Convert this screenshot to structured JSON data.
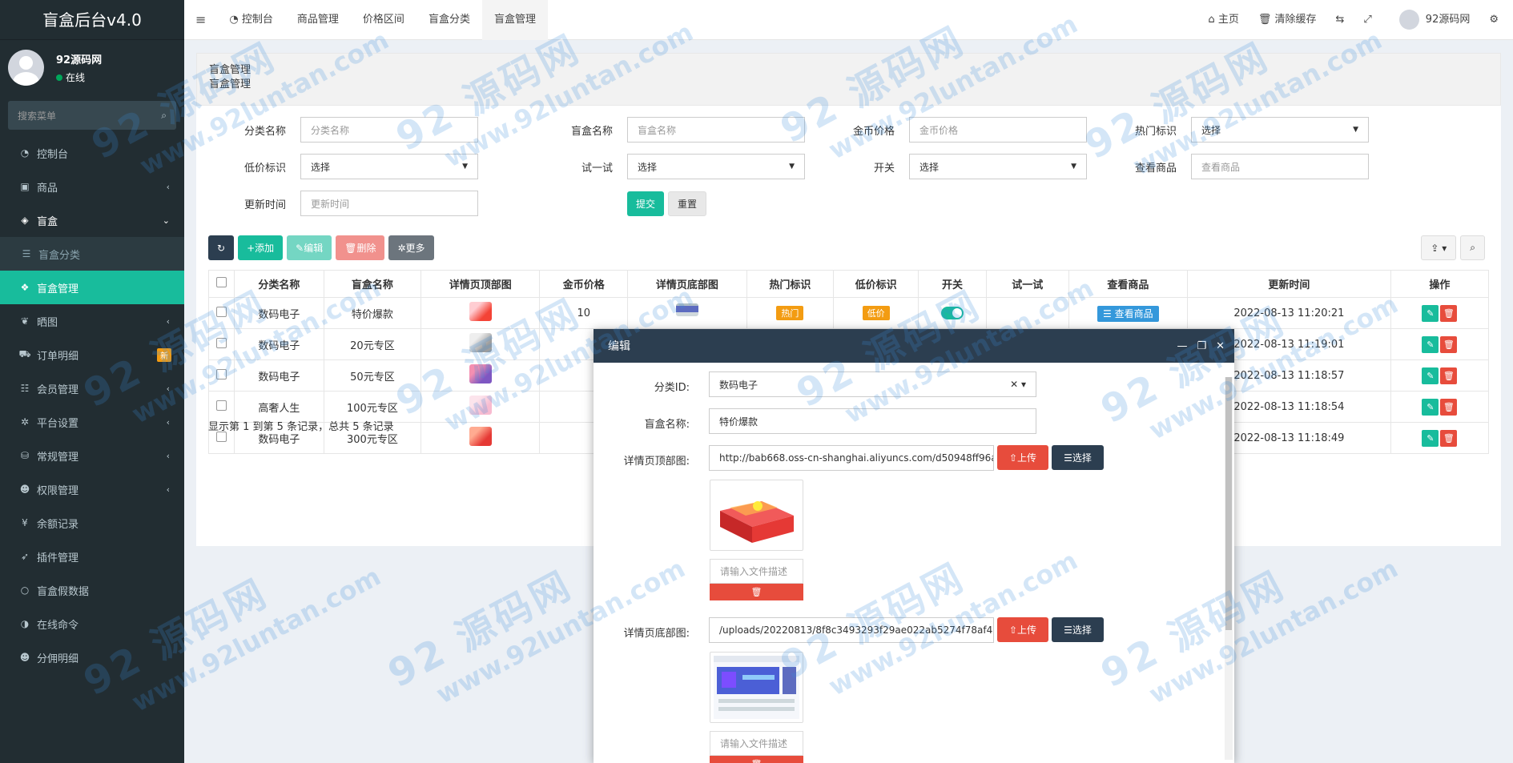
{
  "sidebar": {
    "logo": "盲盒后台v4.0",
    "user_name": "92源码网",
    "user_status": "在线",
    "search_placeholder": "搜索菜单",
    "items": [
      {
        "label": "控制台",
        "icon": "dashboard-icon",
        "glyph": "◔"
      },
      {
        "label": "商品",
        "icon": "shopping-bag-icon",
        "glyph": "▣"
      },
      {
        "label": "盲盒",
        "icon": "cube-icon",
        "glyph": "◈"
      },
      {
        "label": "盲盒分类",
        "icon": "list-icon",
        "glyph": "☰"
      },
      {
        "label": "盲盒管理",
        "icon": "cubes-icon",
        "glyph": "❖"
      },
      {
        "label": "晒图",
        "icon": "image-icon",
        "glyph": "❦"
      },
      {
        "label": "订单明细",
        "icon": "cart-icon",
        "glyph": "⛟",
        "badge": "新"
      },
      {
        "label": "会员管理",
        "icon": "users-list-icon",
        "glyph": "☷"
      },
      {
        "label": "平台设置",
        "icon": "cog-icon",
        "glyph": "✲"
      },
      {
        "label": "常规管理",
        "icon": "database-icon",
        "glyph": "⛁"
      },
      {
        "label": "权限管理",
        "icon": "group-icon",
        "glyph": "☻"
      },
      {
        "label": "余额记录",
        "icon": "yen-icon",
        "glyph": "¥"
      },
      {
        "label": "插件管理",
        "icon": "rocket-icon",
        "glyph": "➶"
      },
      {
        "label": "盲盒假数据",
        "icon": "circle-icon",
        "glyph": "○"
      },
      {
        "label": "在线命令",
        "icon": "contrast-icon",
        "glyph": "◑"
      },
      {
        "label": "分佣明细",
        "icon": "group2-icon",
        "glyph": "☻"
      }
    ]
  },
  "header": {
    "tabs": [
      "控制台",
      "商品管理",
      "价格区间",
      "盲盒分类",
      "盲盒管理"
    ],
    "right": {
      "home": "主页",
      "clear_cache": "清除缓存",
      "user": "92源码网"
    }
  },
  "breadcrumb": {
    "title": "盲盒管理",
    "sub": "盲盒管理"
  },
  "filters": {
    "category_label": "分类名称",
    "category_ph": "分类名称",
    "name_label": "盲盒名称",
    "name_ph": "盲盒名称",
    "price_label": "金币价格",
    "price_ph": "金币价格",
    "hot_label": "热门标识",
    "hot_value": "选择",
    "low_label": "低价标识",
    "low_value": "选择",
    "try_label": "试一试",
    "try_value": "选择",
    "switch_label": "开关",
    "switch_value": "选择",
    "view_label": "查看商品",
    "view_ph": "查看商品",
    "time_label": "更新时间",
    "time_ph": "更新时间",
    "submit": "提交",
    "reset": "重置"
  },
  "toolbar": {
    "add": "添加",
    "edit": "编辑",
    "delete": "删除",
    "more": "更多"
  },
  "table": {
    "headers": [
      "分类名称",
      "盲盒名称",
      "详情页顶部图",
      "金币价格",
      "详情页底部图",
      "热门标识",
      "低价标识",
      "开关",
      "试一试",
      "查看商品",
      "更新时间",
      "操作"
    ],
    "rows": [
      {
        "category": "数码电子",
        "name": "特价爆款",
        "price": "10",
        "hot": "热门",
        "low": "低价",
        "view": "查看商品",
        "time": "2022-08-13 11:20:21"
      },
      {
        "category": "数码电子",
        "name": "20元专区",
        "price": "",
        "hot": "",
        "low": "",
        "view": "",
        "time": "2022-08-13 11:19:01"
      },
      {
        "category": "数码电子",
        "name": "50元专区",
        "price": "",
        "hot": "",
        "low": "",
        "view": "",
        "time": "2022-08-13 11:18:57"
      },
      {
        "category": "高奢人生",
        "name": "100元专区",
        "price": "",
        "hot": "",
        "low": "",
        "view": "",
        "time": "2022-08-13 11:18:54"
      },
      {
        "category": "数码电子",
        "name": "300元专区",
        "price": "",
        "hot": "",
        "low": "",
        "view": "",
        "time": "2022-08-13 11:18:49"
      }
    ],
    "pager": "显示第 1 到第 5 条记录，总共 5 条记录"
  },
  "modal": {
    "title": "编辑",
    "category_label": "分类ID:",
    "category_value": "数码电子",
    "name_label": "盲盒名称:",
    "name_value": "特价爆款",
    "top_label": "详情页顶部图:",
    "top_value": "http://bab668.oss-cn-shanghai.aliyuncs.com/d50948ff96a0ed",
    "bottom_label": "详情页底部图:",
    "bottom_value": "/uploads/20220813/8f8c3493293f29ae022ab5274f78af45.pn",
    "upload": "上传",
    "select": "选择",
    "desc_ph": "请输入文件描述"
  },
  "watermark": {
    "line1": "92 源码网",
    "line2": "www.92luntan.com"
  },
  "colors": {
    "sidebar": "#222d32",
    "accent": "#18bc9c",
    "danger": "#e74c3c",
    "dark": "#2c3e50",
    "warning": "#f39c12"
  }
}
